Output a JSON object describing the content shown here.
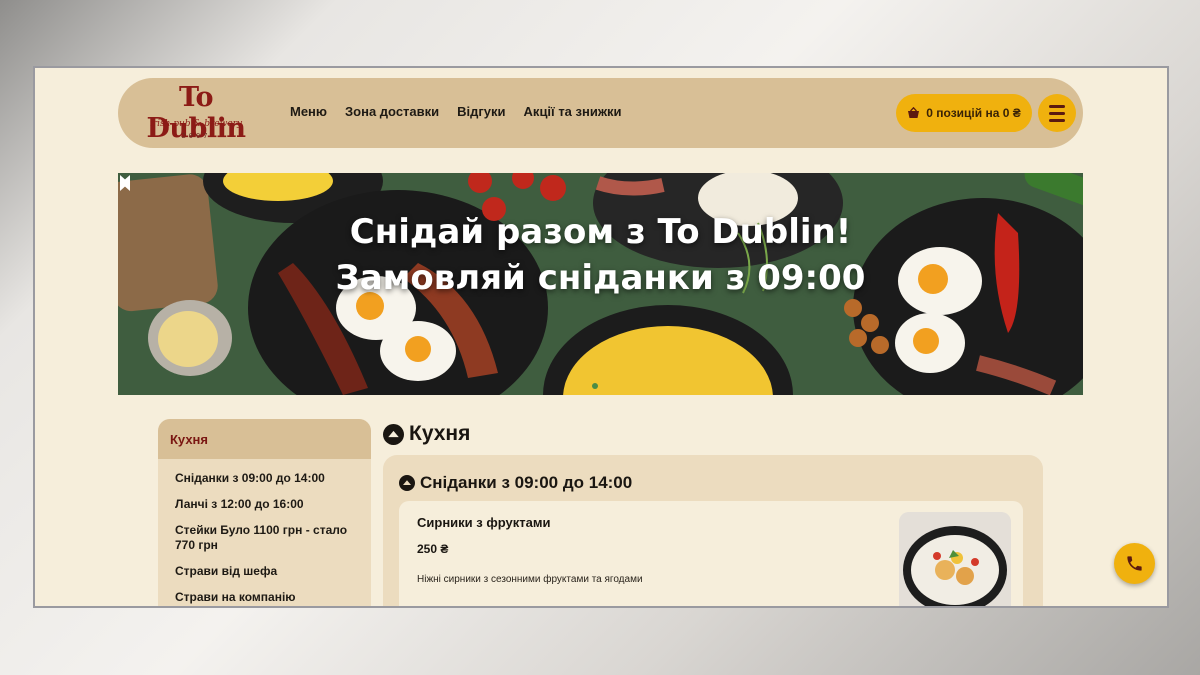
{
  "logo": {
    "title": "To Dublin",
    "subtitle": "irish pub & brewery",
    "year": "2007"
  },
  "nav": [
    {
      "label": "Меню"
    },
    {
      "label": "Зона доставки"
    },
    {
      "label": "Відгуки"
    },
    {
      "label": "Акції та знижки"
    }
  ],
  "cart": {
    "label": "0 позицій на 0 ₴",
    "icon": "basket-icon"
  },
  "menu_button": {
    "icon": "hamburger-icon"
  },
  "banner": {
    "line1": "Снідай разом з To Dublin!",
    "line2": "Замовляй сніданки з 09:00"
  },
  "sidebar": {
    "title": "Кухня",
    "items": [
      {
        "label": "Сніданки з 09:00 до 14:00"
      },
      {
        "label": "Ланчі з 12:00 до 16:00"
      },
      {
        "label": "Стейки Було 1100 грн - стало 770 грн"
      },
      {
        "label": "Страви від шефа"
      },
      {
        "label": "Страви на компанію"
      }
    ]
  },
  "main": {
    "title": "Кухня",
    "section": {
      "title": "Сніданки з 09:00 до 14:00",
      "items": [
        {
          "name": "Сирники з фруктами",
          "price": "250 ₴",
          "description": "Ніжні сирники з сезонними фруктами та ягодами"
        }
      ]
    }
  },
  "colors": {
    "page_bg": "#f6eedb",
    "header_bg": "#d8bf96",
    "accent": "#f0b10e",
    "brand": "#8c1b16"
  }
}
